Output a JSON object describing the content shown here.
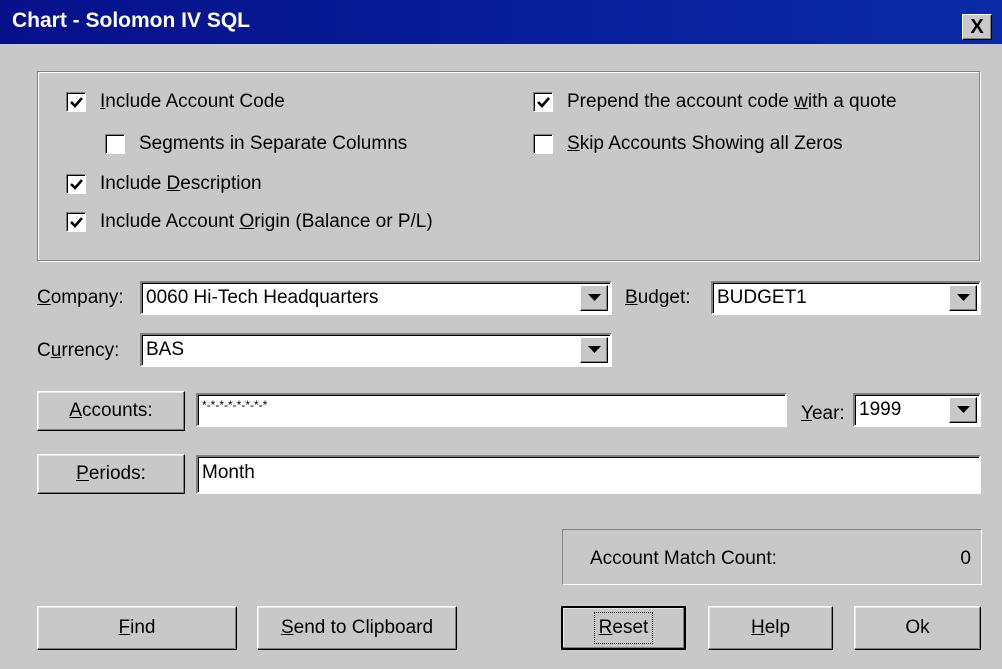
{
  "window": {
    "title": "Chart - Solomon IV SQL",
    "close_label": "X"
  },
  "options": {
    "include_account_code": {
      "label_pre": "",
      "label_key": "I",
      "label_post": "nclude Account Code",
      "checked": true
    },
    "segments_separate": {
      "label": "Segments in Separate Columns",
      "checked": false
    },
    "include_description": {
      "label_pre": "Include ",
      "label_key": "D",
      "label_post": "escription",
      "checked": true
    },
    "include_origin": {
      "label_pre": "Include Account ",
      "label_key": "O",
      "label_post": "rigin (Balance or P/L)",
      "checked": true
    },
    "prepend_quote": {
      "label_pre": "Prepend the account code ",
      "label_key": "w",
      "label_post": "ith a quote",
      "checked": true
    },
    "skip_zeros": {
      "label_pre": "",
      "label_key": "S",
      "label_post": "kip Accounts Showing all Zeros",
      "checked": false
    }
  },
  "company": {
    "label_key": "C",
    "label_post": "ompany:",
    "value": "0060 Hi-Tech Headquarters"
  },
  "budget": {
    "label_key": "B",
    "label_post": "udget:",
    "value": "BUDGET1"
  },
  "currency": {
    "label_pre": "C",
    "label_key": "u",
    "label_post": "rrency:",
    "value": "BAS"
  },
  "accounts": {
    "button_key": "A",
    "button_post": "ccounts:",
    "value": "*-*-*-*-*-*-*-*"
  },
  "year": {
    "label_key": "Y",
    "label_post": "ear:",
    "value": "1999"
  },
  "periods": {
    "button_key": "P",
    "button_post": "eriods:",
    "value": "Month"
  },
  "match": {
    "label": "Account Match Count:",
    "count": "0"
  },
  "buttons": {
    "find": {
      "key": "F",
      "post": "ind"
    },
    "clipboard": {
      "key": "S",
      "post": "end to Clipboard"
    },
    "reset": {
      "key": "R",
      "post": "eset"
    },
    "help": {
      "key": "H",
      "post": "elp"
    },
    "ok": {
      "label": "Ok"
    }
  },
  "colors": {
    "titlebar": "#0a1a9a",
    "face": "#c8c8c8"
  }
}
